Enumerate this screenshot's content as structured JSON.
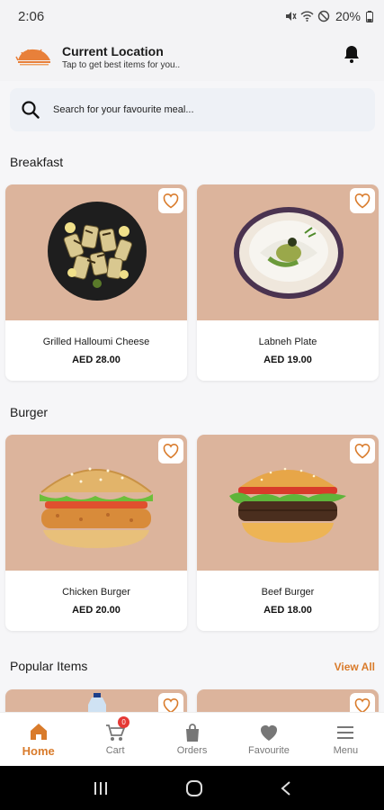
{
  "status_bar": {
    "time": "2:06",
    "battery": "20%"
  },
  "header": {
    "location_title": "Current Location",
    "location_subtitle": "Tap to get best items for you.."
  },
  "search": {
    "placeholder": "Search for your favourite meal..."
  },
  "sections": [
    {
      "title": "Breakfast",
      "items": [
        {
          "name": "Grilled Halloumi Cheese",
          "price": "AED 28.00"
        },
        {
          "name": "Labneh Plate",
          "price": "AED 19.00"
        }
      ]
    },
    {
      "title": "Burger",
      "items": [
        {
          "name": "Chicken Burger",
          "price": "AED 20.00"
        },
        {
          "name": "Beef Burger",
          "price": "AED 18.00"
        }
      ]
    },
    {
      "title": "Popular Items",
      "action": "View All"
    }
  ],
  "bottom_nav": [
    {
      "label": "Home",
      "icon": "home-icon",
      "active": true
    },
    {
      "label": "Cart",
      "icon": "cart-icon",
      "badge": "0"
    },
    {
      "label": "Orders",
      "icon": "bag-icon"
    },
    {
      "label": "Favourite",
      "icon": "heart-icon"
    },
    {
      "label": "Menu",
      "icon": "menu-icon"
    }
  ],
  "colors": {
    "accent": "#d97b2b",
    "card_image_bg": "#dcb49c",
    "badge": "#e53935"
  }
}
